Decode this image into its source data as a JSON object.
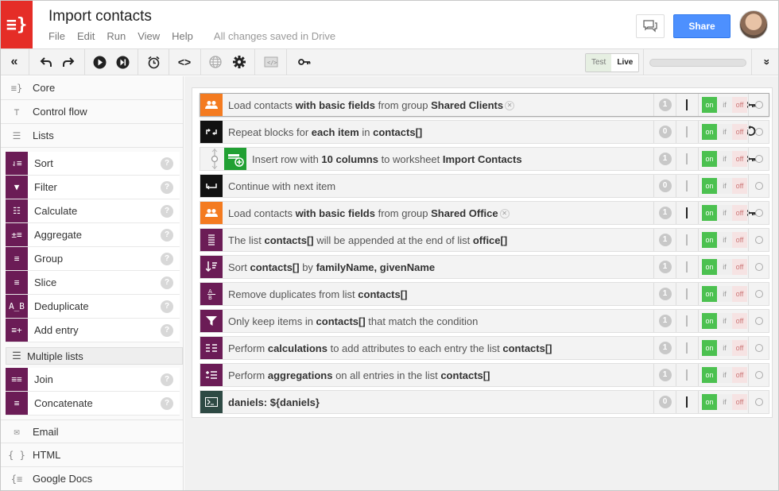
{
  "app": {
    "title": "Import contacts",
    "logo_text": "≡}",
    "menu": [
      "File",
      "Edit",
      "Run",
      "View",
      "Help"
    ],
    "save_status": "All changes saved in Drive",
    "share_label": "Share"
  },
  "toolbar": {
    "mode_test": "Test",
    "mode_live": "Live"
  },
  "sidebar": {
    "categories_top": [
      {
        "label": "Core",
        "icon": "≡}"
      },
      {
        "label": "Control flow",
        "icon": "⊤"
      },
      {
        "label": "Lists",
        "icon": "☰"
      }
    ],
    "list_blocks": [
      {
        "label": "Sort",
        "icon": "⇃≡"
      },
      {
        "label": "Filter",
        "icon": "▼"
      },
      {
        "label": "Calculate",
        "icon": "☷"
      },
      {
        "label": "Aggregate",
        "icon": "±≡"
      },
      {
        "label": "Group",
        "icon": "≡"
      },
      {
        "label": "Slice",
        "icon": "≡"
      },
      {
        "label": "Deduplicate",
        "icon": "A̲B"
      },
      {
        "label": "Add entry",
        "icon": "≡+"
      }
    ],
    "multiple_lists_label": "Multiple lists",
    "multiple_blocks": [
      {
        "label": "Join",
        "icon": "≡≡"
      },
      {
        "label": "Concatenate",
        "icon": "≡"
      }
    ],
    "categories_bottom": [
      {
        "label": "Email",
        "icon": "✉"
      },
      {
        "label": "HTML",
        "icon": "{ }"
      },
      {
        "label": "Google Docs",
        "icon": "{≡"
      }
    ],
    "help_glyph": "?"
  },
  "toggle": {
    "on": "on",
    "if": "if",
    "off": "off"
  },
  "rows": [
    {
      "prefix": "Load contacts ",
      "b1": "with basic fields",
      "mid": " from group ",
      "b2": "Shared Clients",
      "suffix": "",
      "b3": "",
      "count": "1",
      "icon_color": "#f47b20",
      "icon": "group-icon",
      "chip": true,
      "actions": [
        "key-icon"
      ],
      "desc_dark": true,
      "selected": true
    },
    {
      "prefix": "Repeat blocks for ",
      "b1": "each item",
      "mid": " in ",
      "b2": "contacts[]",
      "suffix": "",
      "b3": "",
      "count": "0",
      "icon_color": "#111111",
      "icon": "loop-icon",
      "chip": false,
      "actions": [
        "refresh-icon"
      ],
      "desc_dark": false,
      "selected": false
    },
    {
      "prefix": "Insert row with ",
      "b1": "10 columns",
      "mid": " to worksheet ",
      "b2": "Import Contacts",
      "suffix": "",
      "b3": "",
      "count": "1",
      "icon_color": "#21a033",
      "icon": "sheet-add-icon",
      "chip": false,
      "actions": [
        "open-external-icon",
        "refresh-icon",
        "key-icon"
      ],
      "desc_dark": false,
      "selected": false,
      "indent": true
    },
    {
      "prefix": "Continue with next item",
      "b1": "",
      "mid": "",
      "b2": "",
      "suffix": "",
      "b3": "",
      "count": "0",
      "icon_color": "#111111",
      "icon": "continue-icon",
      "chip": false,
      "actions": [],
      "desc_dark": false,
      "selected": false
    },
    {
      "prefix": "Load contacts ",
      "b1": "with basic fields",
      "mid": " from group ",
      "b2": "Shared Office",
      "suffix": "",
      "b3": "",
      "count": "1",
      "icon_color": "#f47b20",
      "icon": "group-icon",
      "chip": true,
      "actions": [
        "key-icon"
      ],
      "desc_dark": true,
      "selected": false
    },
    {
      "prefix": "The list ",
      "b1": "contacts[]",
      "mid": " will be appended at the end of list ",
      "b2": "office[]",
      "suffix": "",
      "b3": "",
      "count": "1",
      "icon_color": "#6b1c56",
      "icon": "concatenate-icon",
      "chip": false,
      "actions": [],
      "desc_dark": false,
      "selected": false
    },
    {
      "prefix": "Sort ",
      "b1": "contacts[]",
      "mid": " by ",
      "b2": "familyName, givenName",
      "suffix": "",
      "b3": "",
      "count": "1",
      "icon_color": "#6b1c56",
      "icon": "sort-icon",
      "chip": false,
      "actions": [],
      "desc_dark": false,
      "selected": false
    },
    {
      "prefix": "Remove duplicates from list ",
      "b1": "contacts[]",
      "mid": "",
      "b2": "",
      "suffix": "",
      "b3": "",
      "count": "1",
      "icon_color": "#6b1c56",
      "icon": "deduplicate-icon",
      "chip": false,
      "actions": [],
      "desc_dark": false,
      "selected": false
    },
    {
      "prefix": "Only keep items in ",
      "b1": "contacts[]",
      "mid": " that match the condition",
      "b2": "",
      "suffix": "",
      "b3": "",
      "count": "1",
      "icon_color": "#6b1c56",
      "icon": "filter-icon",
      "chip": false,
      "actions": [],
      "desc_dark": false,
      "selected": false
    },
    {
      "prefix": "Perform ",
      "b1": "calculations",
      "mid": " to add attributes to each entry the list ",
      "b2": "contacts[]",
      "suffix": "",
      "b3": "",
      "count": "1",
      "icon_color": "#6b1c56",
      "icon": "calculate-icon",
      "chip": false,
      "actions": [],
      "desc_dark": false,
      "selected": false
    },
    {
      "prefix": "Perform ",
      "b1": "aggregations",
      "mid": " on all entries in the list ",
      "b2": "contacts[]",
      "suffix": "",
      "b3": "",
      "count": "1",
      "icon_color": "#6b1c56",
      "icon": "aggregate-icon",
      "chip": false,
      "actions": [],
      "desc_dark": false,
      "selected": false
    },
    {
      "prefix": "",
      "b1": "daniels: ${daniels}",
      "mid": "",
      "b2": "",
      "suffix": "",
      "b3": "",
      "count": "0",
      "icon_color": "#2e4a44",
      "icon": "terminal-icon",
      "chip": false,
      "actions": [],
      "desc_dark": true,
      "selected": false
    }
  ]
}
